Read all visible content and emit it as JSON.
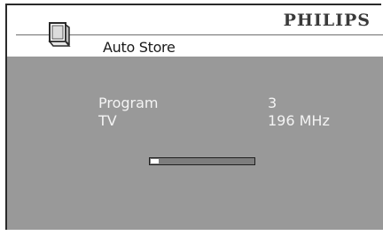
{
  "header": {
    "brand": "PHILIPS",
    "title": "Auto Store",
    "icon": "tv-icon"
  },
  "details": {
    "program_label": "Program",
    "program_value": "3",
    "tv_label": "TV",
    "tv_value": "196 MHz"
  },
  "progress": {
    "fraction": 0.08
  },
  "colors": {
    "panel": "#999999",
    "panel_text": "#f4f4f4",
    "header_bg": "#ffffff",
    "frame": "#2a2a2a"
  }
}
